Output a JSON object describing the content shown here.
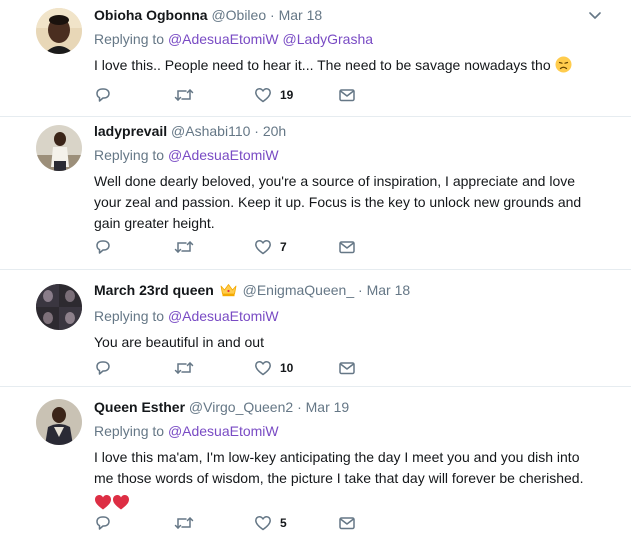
{
  "tweets": [
    {
      "name": "Obioha Ogbonna",
      "handle": "@Obileo",
      "dot": "·",
      "time": "Mar 18",
      "replying_prefix": "Replying to",
      "replying_to": [
        "@AdesuaEtomiW",
        "@LadyGrasha"
      ],
      "text": "I love this.. People need to hear it... The need to be savage nowadays tho",
      "likes": "19"
    },
    {
      "name": "ladyprevail",
      "handle": "@Ashabi110",
      "dot": "·",
      "time": "20h",
      "replying_prefix": "Replying to",
      "replying_to": [
        "@AdesuaEtomiW"
      ],
      "text": "Well done dearly beloved, you're a source of inspiration, I appreciate and love your zeal and passion. Keep it up. Focus is the key to unlock new grounds and gain greater height.",
      "likes": "7"
    },
    {
      "name": "March 23rd queen",
      "handle": "@EnigmaQueen_",
      "dot": "·",
      "time": "Mar 18",
      "replying_prefix": "Replying to",
      "replying_to": [
        "@AdesuaEtomiW"
      ],
      "text": "You are beautiful in and out",
      "likes": "10"
    },
    {
      "name": "Queen Esther",
      "handle": "@Virgo_Queen2",
      "dot": "·",
      "time": "Mar 19",
      "replying_prefix": "Replying to",
      "replying_to": [
        "@AdesuaEtomiW"
      ],
      "text": "I love this ma'am, I'm low-key anticipating the day I meet you and you dish into me those words of wisdom, the picture I take that day will forever be cherished.",
      "likes": "5"
    }
  ],
  "icons": {
    "reply": "reply-icon",
    "retweet": "retweet-icon",
    "like": "heart-icon",
    "dm": "envelope-icon",
    "more": "chevron-down-icon"
  },
  "colors": {
    "link": "#794bc4",
    "secondary_text": "#657786",
    "primary_text": "#14171a",
    "icon": "#657786",
    "divider": "#e6ecf0",
    "emoji_heart": "#e0245e"
  }
}
